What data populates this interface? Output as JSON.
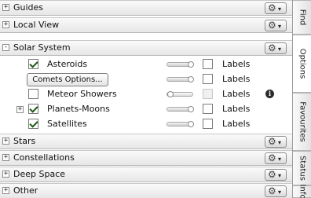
{
  "sections_top": [
    {
      "title": "Guides",
      "expander": "+"
    },
    {
      "title": "Local View",
      "expander": "+"
    },
    {
      "title": "Solar System",
      "expander": "-"
    }
  ],
  "solar_rows": [
    {
      "label": "Asteroids",
      "checked": true,
      "labels_text": "Labels",
      "labels_checked": false,
      "slider_value": 0.75
    },
    {
      "button": "Comets Options...",
      "labels_text": "Labels",
      "labels_checked": false,
      "slider_value": 0.75
    },
    {
      "label": "Meteor Showers",
      "checked": false,
      "labels_text": "Labels",
      "labels_checked": false,
      "labels_disabled": true,
      "slider_value": 0.0,
      "info": "i"
    },
    {
      "label": "Planets-Moons",
      "checked": true,
      "expander": "+",
      "labels_text": "Labels",
      "labels_checked": false,
      "slider_value": 0.75
    },
    {
      "label": "Satellites",
      "checked": true,
      "labels_text": "Labels",
      "labels_checked": false,
      "slider_value": 0.75
    }
  ],
  "sections_bottom": [
    {
      "title": "Stars",
      "expander": "+"
    },
    {
      "title": "Constellations",
      "expander": "+"
    },
    {
      "title": "Deep Space",
      "expander": "+"
    },
    {
      "title": "Other",
      "expander": "+"
    }
  ],
  "gear_icon": "⚙",
  "caret_icon": "▾",
  "tabs": [
    {
      "label": "Find"
    },
    {
      "label": "Options"
    },
    {
      "label": "Favourites"
    },
    {
      "label": "Status"
    },
    {
      "label": "Info"
    }
  ]
}
